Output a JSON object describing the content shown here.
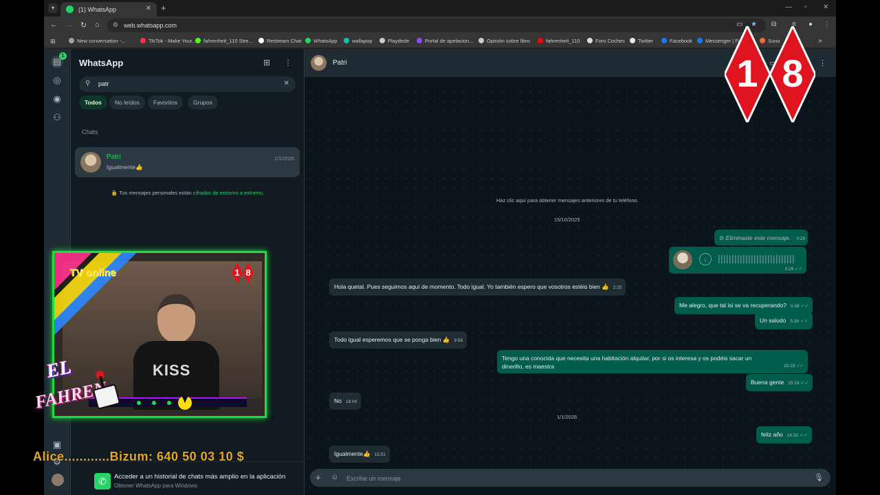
{
  "browser": {
    "tab_title": "(1) WhatsApp",
    "url": "web.whatsapp.com",
    "bookmarks": [
      {
        "label": "New conversation -...",
        "color": "#9aa0a6"
      },
      {
        "label": "TikTok - Make Your...",
        "color": "#ff2f55"
      },
      {
        "label": "fahrenheit_110 Stre...",
        "color": "#53fc18"
      },
      {
        "label": "Restream Chat",
        "color": "#ffffff"
      },
      {
        "label": "WhatsApp",
        "color": "#25d366"
      },
      {
        "label": "wallapop",
        "color": "#13c1ac"
      },
      {
        "label": "Playdede",
        "color": "#cccccc"
      },
      {
        "label": "Portal de apelacion...",
        "color": "#9146ff"
      },
      {
        "label": "Opinión sobre libro",
        "color": "#cccccc"
      },
      {
        "label": "fahrenheit_110",
        "color": "#ff0000"
      },
      {
        "label": "Foro Coches",
        "color": "#dddddd"
      },
      {
        "label": "Twitter",
        "color": "#e7e9ea"
      },
      {
        "label": "Facebook",
        "color": "#1877f2"
      },
      {
        "label": "Messenger | Fa",
        "color": "#1877f2"
      },
      {
        "label": "Suno",
        "color": "#ff6b35"
      }
    ]
  },
  "rail": {
    "badge": "1"
  },
  "sidebar": {
    "title": "WhatsApp",
    "search_value": "patr",
    "filters": [
      "Todos",
      "No leídos",
      "Favoritos",
      "Grupos"
    ],
    "section_label": "Chats",
    "chat": {
      "name": "Patri",
      "preview": "Igualmente👍",
      "date": "1/1/2026"
    },
    "e2e_text": "Tus mensajes personales están ",
    "e2e_link": "cifrados de extremo a extremo.",
    "banner_title": "Acceder a un historial de chats más amplio en la aplicación",
    "banner_sub": "Obtener WhatsApp para Windows"
  },
  "chat": {
    "contact": "Patri",
    "older_hint": "Haz clic aquí para obtener mensajes anteriores de tu teléfono.",
    "date1": "15/10/2025",
    "date2": "1/1/2026",
    "deleted": {
      "text": "Eliminaste este mensaje.",
      "time": "0:29"
    },
    "voice_time": "0:29",
    "messages": [
      {
        "text": "Hola quetal. Pues seguimos aquí de momento. Todo igual. Yo también espero que vosotros estéis bien 👍",
        "time": "2:25"
      },
      {
        "text": "Me alegro, que tal isi se va recuperando?",
        "time": "5:38"
      },
      {
        "text": "Un saludo",
        "time": "5:38"
      },
      {
        "text": "Todo igual esperemos que se ponga bien 👍",
        "time": "9:58"
      },
      {
        "text": "Tengo una conocida que necesita una habitación alquilar, por si os interesa y os podéis sacar un dinerillo, es maestra",
        "time": "15:19"
      },
      {
        "text": "Buena gente",
        "time": "15:19"
      },
      {
        "text": "No",
        "time": "18:04"
      },
      {
        "text": "feliz año",
        "time": "14:32"
      },
      {
        "text": "Igualmente👍",
        "time": "15:51"
      }
    ],
    "composer_placeholder": "Escribe un mensaje"
  },
  "overlay": {
    "rating_digits": [
      "1",
      "8"
    ],
    "tv_label_a": "TV",
    "tv_label_b": "online",
    "brand_line1": "EL",
    "brand_line2": "FAHREN",
    "shirt_text": "KISS",
    "ticker": "Alice............Bizum: 640 50 03 10 $"
  }
}
